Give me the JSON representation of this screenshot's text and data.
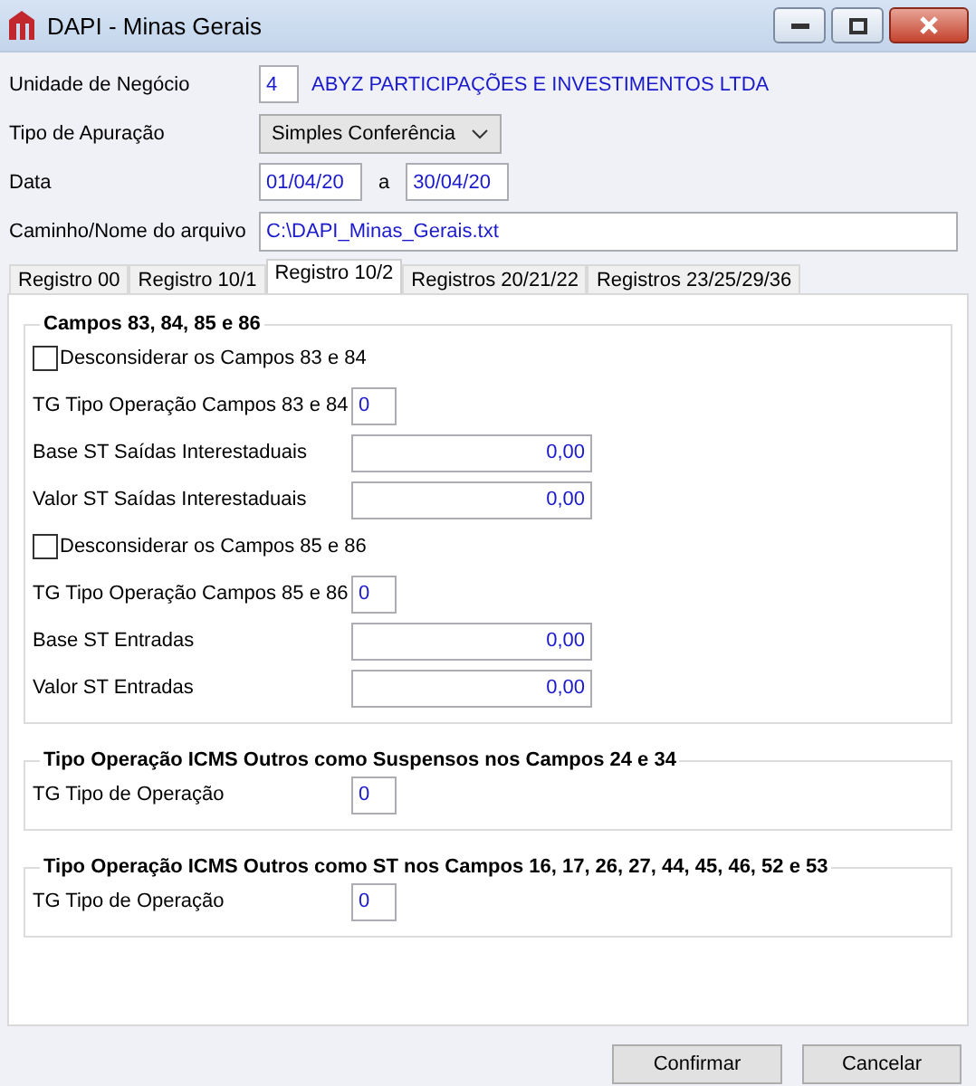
{
  "window": {
    "title": "DAPI - Minas Gerais"
  },
  "header": {
    "unidade": {
      "label": "Unidade de Negócio",
      "code": "4",
      "name": "ABYZ PARTICIPAÇÕES E INVESTIMENTOS LTDA"
    },
    "tipo": {
      "label": "Tipo de Apuração",
      "value": "Simples Conferência"
    },
    "data": {
      "label": "Data",
      "from": "01/04/20",
      "separator": "a",
      "to": "30/04/20"
    },
    "arquivo": {
      "label": "Caminho/Nome do arquivo",
      "value": "C:\\DAPI_Minas_Gerais.txt"
    }
  },
  "tabs": [
    {
      "label": "Registro 00",
      "selected": false
    },
    {
      "label": "Registro 10/1",
      "selected": false
    },
    {
      "label": "Registro 10/2",
      "selected": true
    },
    {
      "label": "Registros 20/21/22",
      "selected": false
    },
    {
      "label": "Registros 23/25/29/36",
      "selected": false
    }
  ],
  "groups": [
    {
      "title": "Campos 83, 84, 85 e 86",
      "rows": [
        {
          "kind": "checkbox",
          "label": "Desconsiderar os Campos 83 e 84",
          "checked": false
        },
        {
          "kind": "code",
          "label": "TG Tipo Operação Campos 83 e 84",
          "value": "0"
        },
        {
          "kind": "amount",
          "label": "Base ST Saídas Interestaduais",
          "value": "0,00"
        },
        {
          "kind": "amount",
          "label": "Valor ST Saídas Interestaduais",
          "value": "0,00"
        },
        {
          "kind": "checkbox",
          "label": "Desconsiderar os Campos 85 e 86",
          "checked": false
        },
        {
          "kind": "code",
          "label": "TG Tipo Operação Campos 85 e 86",
          "value": "0"
        },
        {
          "kind": "amount",
          "label": "Base ST Entradas",
          "value": "0,00"
        },
        {
          "kind": "amount",
          "label": "Valor ST Entradas",
          "value": "0,00"
        }
      ]
    },
    {
      "title": "Tipo Operação ICMS Outros como Suspensos nos Campos 24 e 34",
      "rows": [
        {
          "kind": "code",
          "label": "TG Tipo de Operação",
          "value": "0"
        }
      ]
    },
    {
      "title": "Tipo Operação ICMS Outros como ST nos Campos 16, 17, 26, 27, 44, 45, 46, 52 e 53",
      "rows": [
        {
          "kind": "code",
          "label": "TG Tipo de Operação",
          "value": "0"
        }
      ]
    }
  ],
  "buttons": [
    "Confirmar",
    "Cancelar"
  ]
}
